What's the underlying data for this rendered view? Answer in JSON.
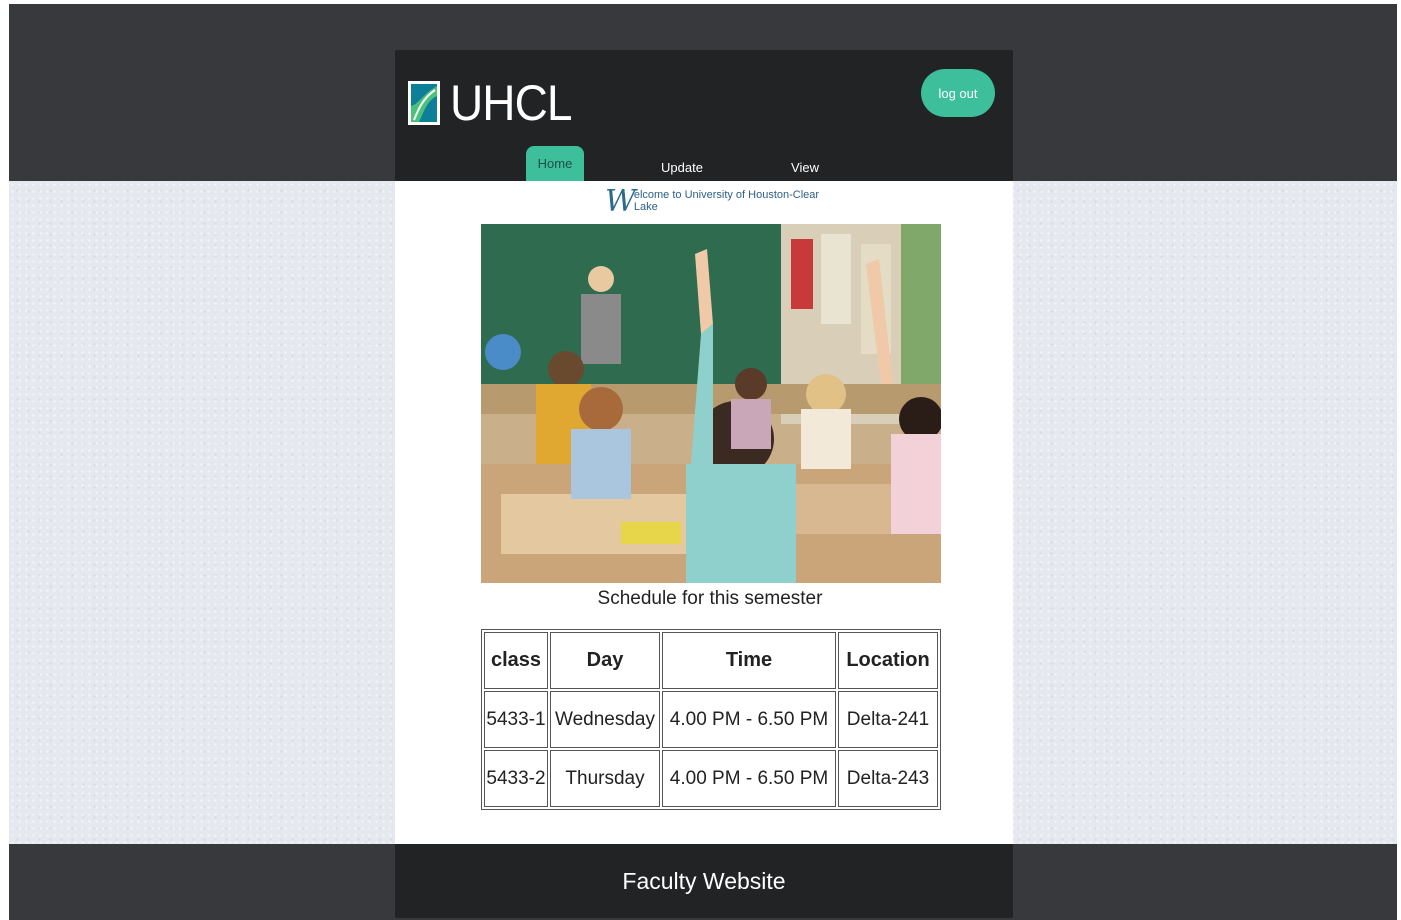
{
  "header": {
    "logo_text": "UHCL",
    "logout_label": "log out"
  },
  "nav": {
    "items": [
      {
        "label": "Home",
        "active": true
      },
      {
        "label": "Update",
        "active": false
      },
      {
        "label": "View",
        "active": false
      }
    ]
  },
  "main": {
    "welcome_initial": "W",
    "welcome_rest": "elcome to University of Houston-Clear Lake",
    "caption": "Schedule for this semester",
    "schedule": {
      "headers": [
        "class",
        "Day",
        "Time",
        "Location"
      ],
      "rows": [
        [
          "5433-1",
          "Wednesday",
          "4.00 PM - 6.50 PM",
          "Delta-241"
        ],
        [
          "5433-2",
          "Thursday",
          "4.00 PM - 6.50 PM",
          "Delta-243"
        ]
      ]
    }
  },
  "footer": {
    "text": "Faculty Website"
  },
  "colors": {
    "accent": "#3dbf9c",
    "dark": "#222325",
    "band": "#38393d"
  },
  "icons": {
    "logo": "uhcl-logo-icon"
  }
}
